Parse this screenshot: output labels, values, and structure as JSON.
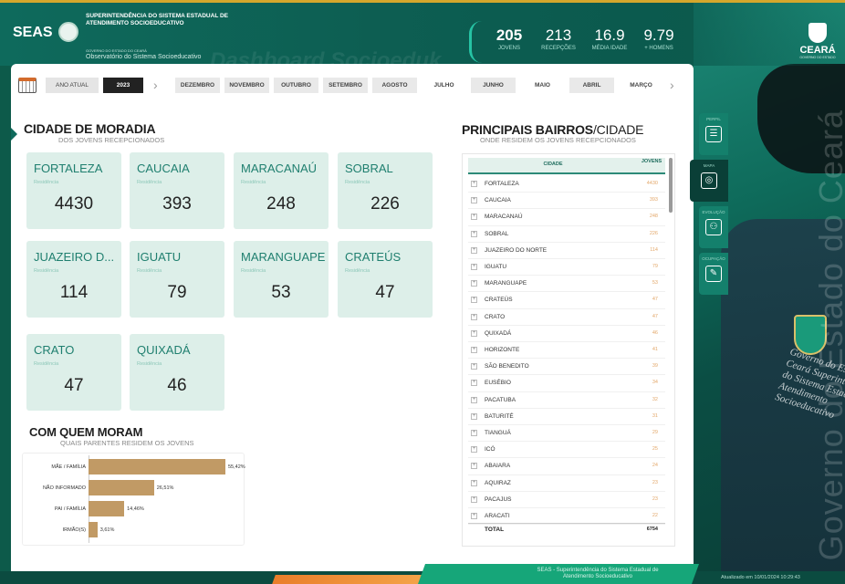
{
  "header": {
    "logo_text": "SEAS",
    "org_name": "SUPERINTENDÊNCIA DO SISTEMA ESTADUAL DE ATENDIMENTO SOCIOEDUCATIVO",
    "org_sub": "GOVERNO DO ESTADO DO CEARÁ",
    "observatory": "Observatório do Sistema Socioeducativo",
    "dashboard_title": "Dashboard Socioeduk",
    "kpis": [
      {
        "value": "205",
        "label": "JOVENS"
      },
      {
        "value": "213",
        "label": "RECEPÇÕES"
      },
      {
        "value": "16.9",
        "label": "MÉDIA IDADE"
      },
      {
        "value": "9.79",
        "label": "+ HOMENS"
      }
    ],
    "state_logo": "CEARÁ",
    "state_sub": "GOVERNO DO ESTADO"
  },
  "filters": {
    "current_year_label": "ANO ATUAL",
    "year": "2023",
    "months": [
      "DEZEMBRO",
      "NOVEMBRO",
      "OUTUBRO",
      "SETEMBRO",
      "AGOSTO",
      "JULHO",
      "JUNHO",
      "MAIO",
      "ABRIL",
      "MARÇO"
    ]
  },
  "cidade": {
    "title": "CIDADE DE MORADIA",
    "subtitle": "DOS JOVENS RECEPCIONADOS",
    "residencia_label": "Residência",
    "tiles": [
      {
        "name": "FORTALEZA",
        "value": "4430"
      },
      {
        "name": "CAUCAIA",
        "value": "393"
      },
      {
        "name": "MARACANAÚ",
        "value": "248"
      },
      {
        "name": "SOBRAL",
        "value": "226"
      },
      {
        "name": "JUAZEIRO D...",
        "value": "114"
      },
      {
        "name": "IGUATU",
        "value": "79"
      },
      {
        "name": "MARANGUAPE",
        "value": "53"
      },
      {
        "name": "CRATEÚS",
        "value": "47"
      },
      {
        "name": "CRATO",
        "value": "47"
      },
      {
        "name": "QUIXADÁ",
        "value": "46"
      }
    ]
  },
  "moram": {
    "title": "COM QUEM MORAM",
    "subtitle": "QUAIS PARENTES RESIDEM OS JOVENS",
    "bars": [
      {
        "label": "MÃE / FAMÍLIA",
        "value": 55.42,
        "pct": "55,42%"
      },
      {
        "label": "NÃO INFORMADO",
        "value": 26.51,
        "pct": "26,51%"
      },
      {
        "label": "PAI / FAMÍLIA",
        "value": 14.46,
        "pct": "14,46%"
      },
      {
        "label": "IRMÃO(S)",
        "value": 3.61,
        "pct": "3,61%"
      }
    ]
  },
  "bairros": {
    "title_bold": "PRINCIPAIS BAIRROS",
    "title_light": "/CIDADE",
    "subtitle": "ONDE RESIDEM OS JOVENS RECEPCIONADOS",
    "col_city": "CIDADE",
    "col_jovens": "JOVENS",
    "expand": "+",
    "rows": [
      {
        "name": "FORTALEZA",
        "value": "4430"
      },
      {
        "name": "CAUCAIA",
        "value": "393"
      },
      {
        "name": "MARACANAÚ",
        "value": "248"
      },
      {
        "name": "SOBRAL",
        "value": "226"
      },
      {
        "name": "JUAZEIRO DO NORTE",
        "value": "114"
      },
      {
        "name": "IGUATU",
        "value": "79"
      },
      {
        "name": "MARANGUAPE",
        "value": "53"
      },
      {
        "name": "CRATEÚS",
        "value": "47"
      },
      {
        "name": "CRATO",
        "value": "47"
      },
      {
        "name": "QUIXADÁ",
        "value": "46"
      },
      {
        "name": "HORIZONTE",
        "value": "41"
      },
      {
        "name": "SÃO BENEDITO",
        "value": "39"
      },
      {
        "name": "EUSÉBIO",
        "value": "34"
      },
      {
        "name": "PACATUBA",
        "value": "32"
      },
      {
        "name": "BATURITÉ",
        "value": "31"
      },
      {
        "name": "TIANGUÁ",
        "value": "29"
      },
      {
        "name": "ICÓ",
        "value": "25"
      },
      {
        "name": "ABAIARA",
        "value": "24"
      },
      {
        "name": "AQUIRAZ",
        "value": "23"
      },
      {
        "name": "PACAJUS",
        "value": "23"
      },
      {
        "name": "ARACATI",
        "value": "22"
      }
    ],
    "total_label": "TOTAL",
    "total_value": "6754"
  },
  "sidenav": [
    {
      "label": "PERFIL",
      "icon": "id-card-icon",
      "glyph": "☰"
    },
    {
      "label": "MAPA",
      "icon": "globe-icon",
      "glyph": "◎"
    },
    {
      "label": "EVOLUÇÃO",
      "icon": "people-icon",
      "glyph": "⚇"
    },
    {
      "label": "OCUPAÇÃO",
      "icon": "pen-icon",
      "glyph": "✎"
    }
  ],
  "footer": {
    "text": "SEAS - Superintendência do Sistema Estadual de Atendimento Socioeducativo",
    "updated": "Atualizado em 10/01/2024 10:29:43"
  },
  "background": {
    "watermark": "Governo do Estado do Ceará",
    "embroidery": "Governo do Estado do Ceará Superintendência do Sistema Estadual de Atendimento Socioeducativo"
  },
  "colors": {
    "brand": "#0e6a5c",
    "tile": "#ddefe9",
    "bar": "#c19a65",
    "accent": "#26c3a4"
  }
}
